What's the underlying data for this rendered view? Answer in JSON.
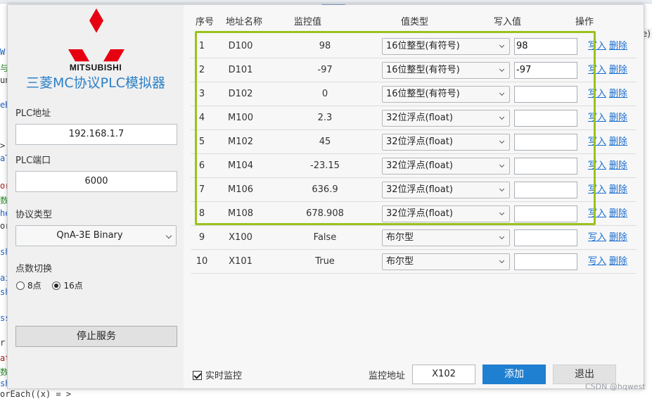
{
  "background_ide": {
    "code_fragments": [
      {
        "text": "W",
        "color": "#1b5fbf"
      },
      {
        "text": "与",
        "color": "#2e8b2e"
      },
      {
        "text": "un",
        "color": "#333333"
      },
      {
        "text": "eB",
        "color": "#1b5fbf"
      },
      {
        "text": ">",
        "color": "#333333"
      },
      {
        "text": "aT",
        "color": "#1b5fbf"
      },
      {
        "text": "or",
        "color": "#a31515"
      },
      {
        "text": "数",
        "color": "#2e8b2e"
      },
      {
        "text": "he",
        "color": "#1b5fbf"
      },
      {
        "text": "or",
        "color": "#333333"
      },
      {
        "text": "sh",
        "color": "#1b5fbf"
      },
      {
        "text": "ai",
        "color": "#1b5fbf"
      },
      {
        "text": "sh",
        "color": "#1b5fbf"
      },
      {
        "text": "ss",
        "color": "#1b5fbf"
      },
      {
        "text": "r",
        "color": "#333333"
      },
      {
        "text": "at",
        "color": "#a31515"
      },
      {
        "text": "数",
        "color": "#2e8b2e"
      },
      {
        "text": "sh",
        "color": "#1b5fbf"
      },
      {
        "text": "lo",
        "color": "#1b5fbf"
      }
    ],
    "right_fragment": "e)",
    "bottom_fragment": "orEach((x) = >"
  },
  "sidebar": {
    "brand": "MITSUBISHI",
    "app_title": "三菱MC协议PLC模拟器",
    "plc_address_label": "PLC地址",
    "plc_address_value": "192.168.1.7",
    "plc_port_label": "PLC端口",
    "plc_port_value": "6000",
    "protocol_label": "协议类型",
    "protocol_value": "QnA-3E Binary",
    "points_label": "点数切换",
    "radio_8": "8点",
    "radio_16": "16点",
    "radio_selected": "16点",
    "stop_button": "停止服务"
  },
  "table": {
    "headers": {
      "index": "序号",
      "address": "地址名称",
      "monitor": "监控值",
      "type": "值类型",
      "write": "写入值",
      "ops": "操作"
    },
    "op_write": "写入",
    "op_delete": "删除",
    "rows": [
      {
        "index": "1",
        "address": "D100",
        "monitor": "98",
        "type": "16位整型(有符号)",
        "write": "98"
      },
      {
        "index": "2",
        "address": "D101",
        "monitor": "-97",
        "type": "16位整型(有符号)",
        "write": "-97"
      },
      {
        "index": "3",
        "address": "D102",
        "monitor": "0",
        "type": "16位整型(有符号)",
        "write": ""
      },
      {
        "index": "4",
        "address": "M100",
        "monitor": "2.3",
        "type": "32位浮点(float)",
        "write": ""
      },
      {
        "index": "5",
        "address": "M102",
        "monitor": "45",
        "type": "32位浮点(float)",
        "write": ""
      },
      {
        "index": "6",
        "address": "M104",
        "monitor": "-23.15",
        "type": "32位浮点(float)",
        "write": ""
      },
      {
        "index": "7",
        "address": "M106",
        "monitor": "636.9",
        "type": "32位浮点(float)",
        "write": ""
      },
      {
        "index": "8",
        "address": "M108",
        "monitor": "678.908",
        "type": "32位浮点(float)",
        "write": ""
      },
      {
        "index": "9",
        "address": "X100",
        "monitor": "False",
        "type": "布尔型",
        "write": ""
      },
      {
        "index": "10",
        "address": "X101",
        "monitor": "True",
        "type": "布尔型",
        "write": ""
      }
    ]
  },
  "footer": {
    "realtime_label": "实时监控",
    "realtime_checked": true,
    "monitor_address_label": "监控地址",
    "monitor_address_value": "X102",
    "add_button": "添加",
    "exit_button": "退出"
  },
  "watermark": "CSDN @hqwest",
  "colors": {
    "accent": "#1f7fd0",
    "title_blue": "#2a7fc7",
    "highlight_border": "#9ac21e",
    "logo_red": "#e60012",
    "link": "#1a6fd0"
  }
}
